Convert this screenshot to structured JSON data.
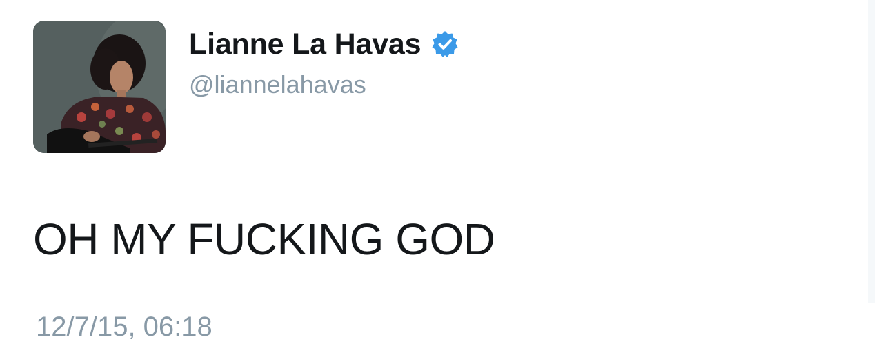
{
  "tweet": {
    "author": {
      "display_name": "Lianne La Havas",
      "handle": "@liannelahavas",
      "verified": true,
      "avatar_icon": "profile-photo",
      "verified_badge_color": "#3b9ae8"
    },
    "text": "OH MY FUCKING GOD",
    "timestamp": "12/7/15, 06:18"
  },
  "colors": {
    "name": "#14171a",
    "secondary": "#8899a6",
    "background": "#ffffff"
  }
}
